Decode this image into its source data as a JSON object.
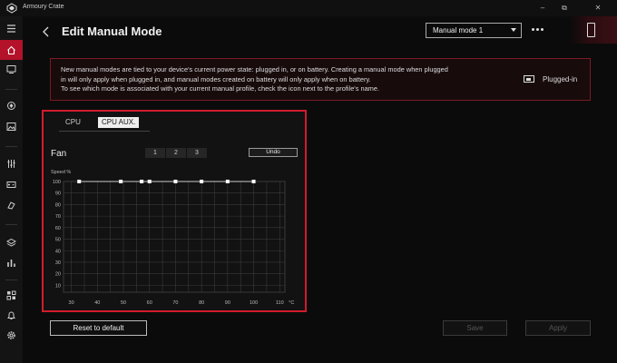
{
  "app": {
    "title": "Armoury Crate"
  },
  "window_controls": {
    "minimize": "–",
    "restore": "⧉",
    "close": "✕"
  },
  "header": {
    "title": "Edit Manual Mode",
    "mode_select_value": "Manual mode 1"
  },
  "notice": {
    "lines": [
      "New manual modes are tied to your device's current power state: plugged in, or on battery. Creating a manual mode when plugged",
      "in will only apply when plugged in, and manual modes created on battery will only apply when on battery.",
      "To see which mode is associated with your current manual profile, check the icon next to the profile's name."
    ],
    "power_state_label": "Plugged-in"
  },
  "fan_panel": {
    "tabs": [
      {
        "label": "CPU",
        "selected": false
      },
      {
        "label": "CPU AUX.",
        "selected": true
      }
    ],
    "fan_label": "Fan",
    "presets": [
      "1",
      "2",
      "3"
    ],
    "undo_label": "Undo"
  },
  "chart_data": {
    "type": "line",
    "ylabel": "Speed %",
    "xlabel": "°C",
    "x_ticks": [
      30,
      40,
      50,
      60,
      70,
      80,
      90,
      100,
      110
    ],
    "y_ticks": [
      10,
      20,
      30,
      40,
      50,
      60,
      70,
      80,
      90,
      100
    ],
    "xlim": [
      27,
      112
    ],
    "ylim": [
      4,
      100
    ],
    "grid": true,
    "series": [
      {
        "values": [
          {
            "x": 33,
            "y": 100
          },
          {
            "x": 49,
            "y": 100
          },
          {
            "x": 57,
            "y": 100
          },
          {
            "x": 60,
            "y": 100
          },
          {
            "x": 70,
            "y": 100
          },
          {
            "x": 80,
            "y": 100
          },
          {
            "x": 90,
            "y": 100
          },
          {
            "x": 100,
            "y": 100
          }
        ]
      }
    ],
    "colors": {
      "line": "#cccccc",
      "point": "#ffffff",
      "grid": "#3a3a3a"
    }
  },
  "footer": {
    "reset_label": "Reset to default",
    "save_label": "Save",
    "apply_label": "Apply"
  },
  "colors": {
    "accent": "#d01c2c",
    "sidebar_active": "#b3122a"
  }
}
